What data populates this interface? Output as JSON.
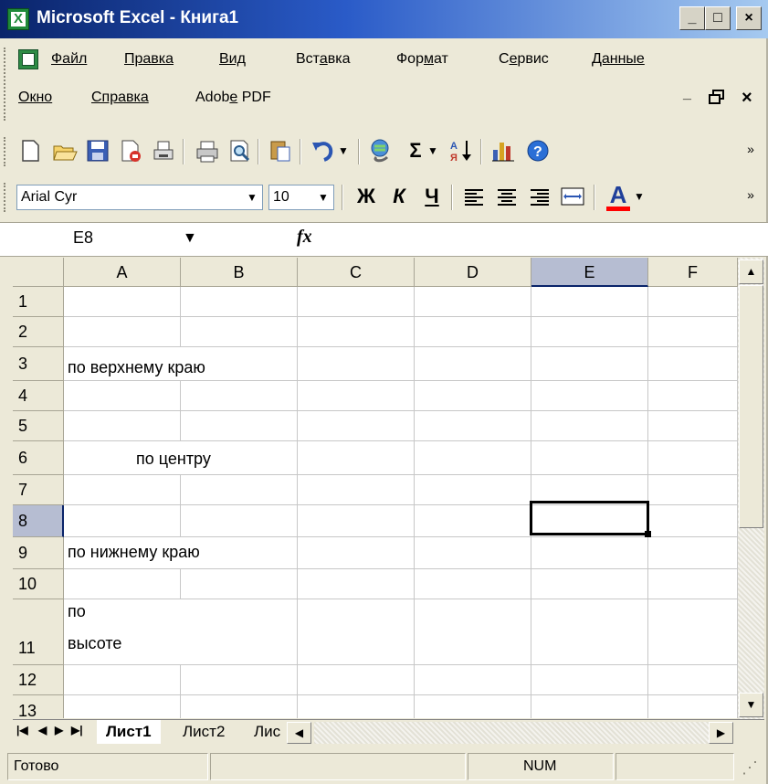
{
  "window": {
    "title": "Microsoft Excel - Книга1",
    "controls": {
      "minimize": "_",
      "maximize": "□",
      "close": "×"
    }
  },
  "menu": {
    "row1": [
      {
        "label": "Файл",
        "underline_index": 0
      },
      {
        "label": "Правка",
        "underline_index": 0
      },
      {
        "label": "Вид",
        "underline_index": 0
      },
      {
        "label": "Вставка",
        "underline_index": 3
      },
      {
        "label": "Формат",
        "underline_index": 3
      },
      {
        "label": "Сервис",
        "underline_index": 1
      },
      {
        "label": "Данные",
        "underline_index": 0
      }
    ],
    "row2": [
      {
        "label": "Окно",
        "underline_index": 0
      },
      {
        "label": "Справка",
        "underline_index": 0
      },
      {
        "label": "Adobe PDF",
        "underline_index": 4
      }
    ],
    "doc_controls": {
      "minimize": "_",
      "restore": "🗗",
      "close": "×"
    }
  },
  "standard_toolbar": {
    "icons": [
      "new-icon",
      "open-icon",
      "save-icon",
      "permission-icon",
      "print-icon",
      "print-preview-icon",
      "spelling-icon",
      "paste-icon",
      "undo-icon",
      "hyperlink-icon",
      "autosum-icon",
      "sort-ascending-icon",
      "chart-wizard-icon",
      "help-icon"
    ]
  },
  "formatting_toolbar": {
    "font_name": "Arial Cyr",
    "font_size": "10",
    "bold": "Ж",
    "italic": "К",
    "underline": "Ч",
    "font_color_letter": "A",
    "font_color": "#ff0000"
  },
  "formula_bar": {
    "name_box": "E8",
    "fx": "fx",
    "formula": ""
  },
  "grid": {
    "columns": [
      "A",
      "B",
      "C",
      "D",
      "E",
      "F"
    ],
    "rows": [
      "1",
      "2",
      "3",
      "4",
      "5",
      "6",
      "7",
      "8",
      "9",
      "10",
      "11",
      "12",
      "13"
    ],
    "selected_column": "E",
    "selected_row": "8",
    "cells": {
      "A3": "по верхнему краю",
      "A6": "по центру",
      "A9": "по нижнему краю",
      "A11_line1": "по",
      "A11_line2": "высоте"
    }
  },
  "sheets": {
    "tabs": [
      "Лист1",
      "Лист2",
      "Лис"
    ],
    "active": "Лист1"
  },
  "status": {
    "ready": "Готово",
    "num": "NUM"
  },
  "colors": {
    "title_bar_start": "#0a246a",
    "title_bar_end": "#a6caf0",
    "selected_header": "#b6bdd2",
    "chrome": "#ece9d8"
  }
}
